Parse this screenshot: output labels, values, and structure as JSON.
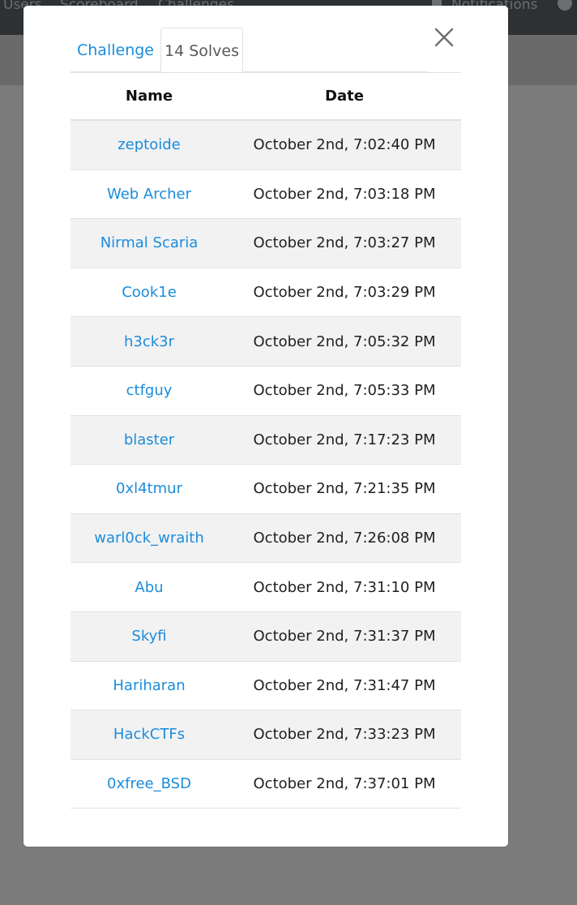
{
  "background": {
    "nav": [
      "Users",
      "Scoreboard",
      "Challenges"
    ],
    "notifications_label": "Notifications",
    "icons": {
      "notifications": "bell-icon",
      "user": "user-circle-icon"
    }
  },
  "modal": {
    "tabs": [
      {
        "label": "Challenge",
        "active": false
      },
      {
        "label": "14 Solves",
        "active": true
      }
    ],
    "close_icon": "close-icon",
    "table": {
      "headers": [
        "Name",
        "Date"
      ],
      "rows": [
        {
          "name": "zeptoide",
          "date": "October 2nd, 7:02:40 PM"
        },
        {
          "name": "Web Archer",
          "date": "October 2nd, 7:03:18 PM"
        },
        {
          "name": "Nirmal Scaria",
          "date": "October 2nd, 7:03:27 PM"
        },
        {
          "name": "Cook1e",
          "date": "October 2nd, 7:03:29 PM"
        },
        {
          "name": "h3ck3r",
          "date": "October 2nd, 7:05:32 PM"
        },
        {
          "name": "ctfguy",
          "date": "October 2nd, 7:05:33 PM"
        },
        {
          "name": "blaster",
          "date": "October 2nd, 7:17:23 PM"
        },
        {
          "name": "0xl4tmur",
          "date": "October 2nd, 7:21:35 PM"
        },
        {
          "name": "warl0ck_wraith",
          "date": "October 2nd, 7:26:08 PM"
        },
        {
          "name": "Abu",
          "date": "October 2nd, 7:31:10 PM"
        },
        {
          "name": "Skyfi",
          "date": "October 2nd, 7:31:37 PM"
        },
        {
          "name": "Hariharan",
          "date": "October 2nd, 7:31:47 PM"
        },
        {
          "name": "HackCTFs",
          "date": "October 2nd, 7:33:23 PM"
        },
        {
          "name": "0xfree_BSD",
          "date": "October 2nd, 7:37:01 PM"
        }
      ]
    }
  },
  "colors": {
    "link": "#1a8cdc",
    "navbar": "#2d3134",
    "backdrop": "#7b7b7b",
    "striped_row": "#f2f2f2"
  }
}
